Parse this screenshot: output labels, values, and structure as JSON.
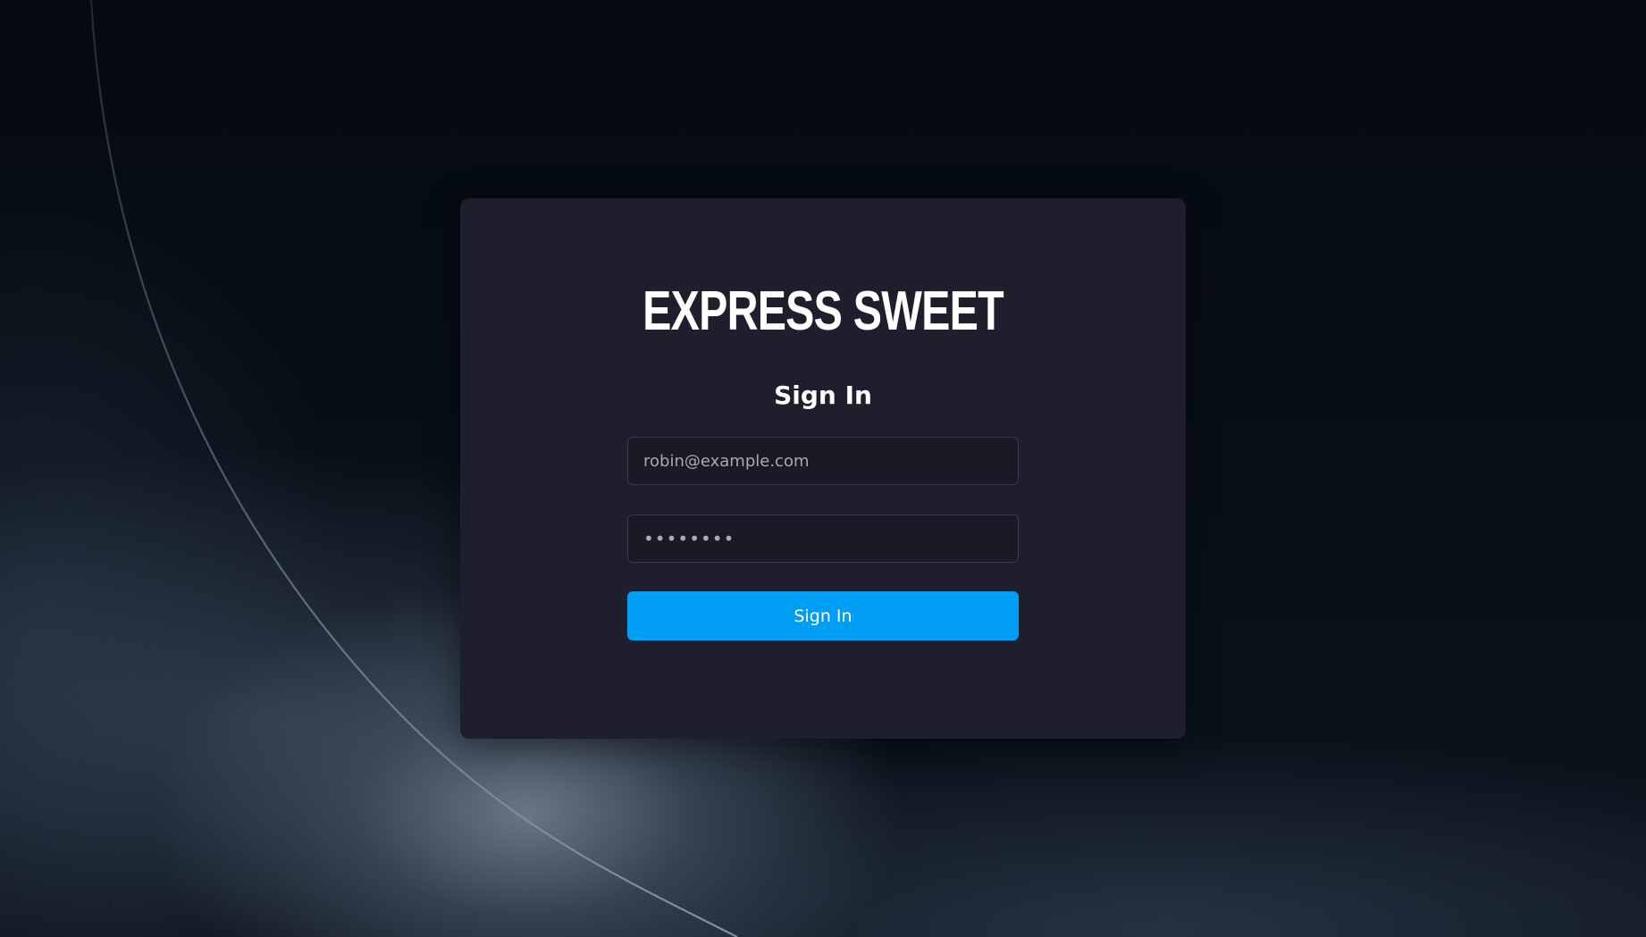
{
  "app": {
    "brand": "EXPRESS SWEET"
  },
  "form": {
    "heading": "Sign In",
    "email_placeholder": "robin@example.com",
    "password_value": "••••••••",
    "submit_label": "Sign In"
  },
  "colors": {
    "card_background": "#1e1e2c",
    "accent": "#009df5",
    "text": "#ffffff",
    "placeholder": "#a7a9b4"
  }
}
